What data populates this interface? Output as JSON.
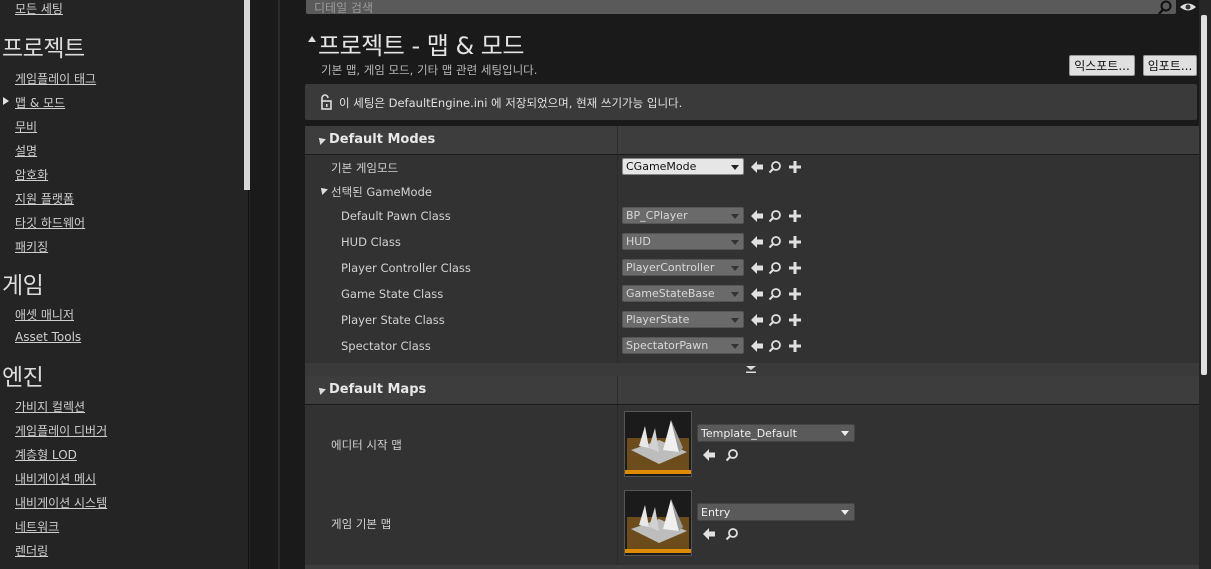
{
  "nav": {
    "top_item": "모든 세팅",
    "categories": [
      {
        "title": "프로젝트",
        "items": [
          "게임플레이 태그",
          "맵 & 모드",
          "무비",
          "설명",
          "암호화",
          "지원 플랫폼",
          "타깃 하드웨어",
          "패키징"
        ]
      },
      {
        "title": "게임",
        "items": [
          "애셋 매니저",
          "Asset Tools"
        ]
      },
      {
        "title": "엔진",
        "items": [
          "가비지 컬렉션",
          "게임플레이 디버거",
          "계층형 LOD",
          "내비게이션 메시",
          "내비게이션 시스템",
          "네트워크",
          "렌더링"
        ]
      }
    ],
    "selected_item": "맵 & 모드"
  },
  "search": {
    "placeholder": "디테일 검색"
  },
  "section": {
    "title": "프로젝트 - 맵 & 모드",
    "description": "기본 맵, 게임 모드, 기타 맵 관련 세팅입니다.",
    "export_label": "익스포트...",
    "import_label": "임포트..."
  },
  "notice": {
    "text": "이 세팅은 DefaultEngine.ini 에 저장되었으며, 현재 쓰기가능 입니다."
  },
  "default_modes": {
    "title": "Default Modes",
    "default_gamemode_label": "기본 게임모드",
    "default_gamemode_value": "CGameMode",
    "selected_group_label": "선택된 GameMode",
    "rows": [
      {
        "label": "Default Pawn Class",
        "value": "BP_CPlayer"
      },
      {
        "label": "HUD Class",
        "value": "HUD"
      },
      {
        "label": "Player Controller Class",
        "value": "PlayerController"
      },
      {
        "label": "Game State Class",
        "value": "GameStateBase"
      },
      {
        "label": "Player State Class",
        "value": "PlayerState"
      },
      {
        "label": "Spectator Class",
        "value": "SpectatorPawn"
      }
    ]
  },
  "default_maps": {
    "title": "Default Maps",
    "editor_startup_label": "에디터 시작 맵",
    "editor_startup_value": "Template_Default",
    "game_default_label": "게임 기본 맵",
    "game_default_value": "Entry"
  },
  "colors": {
    "accent_orange": "#e08a00",
    "panel": "#323232",
    "header": "#3d3d3d"
  }
}
